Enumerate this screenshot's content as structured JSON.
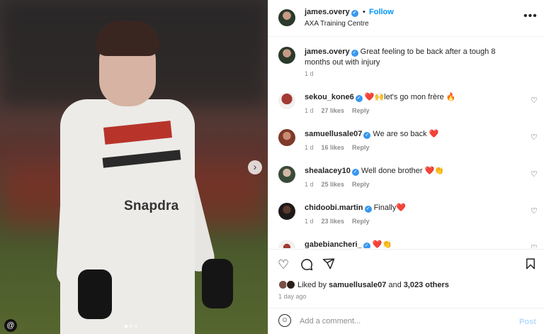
{
  "post": {
    "author": "james.overy",
    "follow_label": "Follow",
    "separator": "•",
    "location": "AXA Training Centre",
    "more_icon": "more-icon",
    "caption": {
      "author": "james.overy",
      "text": "Great feeling to be back after a tough 8 months out with injury",
      "time": "1 d"
    },
    "image_sponsor_text": "Snapdra",
    "carousel": {
      "slide": 1,
      "total": 3
    }
  },
  "comments": [
    {
      "user": "sekou_kone6",
      "text": "❤️🙌let's go mon frère 🔥",
      "time": "1 d",
      "likes": "27 likes",
      "reply": "Reply",
      "avatar_color": "#a33a33"
    },
    {
      "user": "samuellusale07",
      "text": "We are so back ❤️",
      "time": "1 d",
      "likes": "16 likes",
      "reply": "Reply",
      "avatar_color": "#7e3a2a"
    },
    {
      "user": "shealacey10",
      "text": "Well done brother ❤️👏",
      "time": "1 d",
      "likes": "25 likes",
      "reply": "Reply",
      "avatar_color": "#3a4a3a"
    },
    {
      "user": "chidoobi.martin",
      "text": "Finally❤️",
      "time": "1 d",
      "likes": "23 likes",
      "reply": "Reply",
      "avatar_color": "#1d1a19"
    },
    {
      "user": "gabebiancheri_",
      "text": "❤️👏",
      "time": "",
      "likes": "",
      "reply": "",
      "avatar_color": "#f3f0ee"
    }
  ],
  "actions": {
    "like_icon": "heart-icon",
    "comment_icon": "comment-icon",
    "share_icon": "share-icon",
    "save_icon": "bookmark-icon"
  },
  "likes": {
    "prefix": "Liked by",
    "user": "samuellusale07",
    "middle": "and",
    "others": "3,023 others"
  },
  "time_ago": "1 day ago",
  "add_comment": {
    "placeholder": "Add a comment...",
    "post_label": "Post"
  },
  "colors": {
    "accent": "#0095f6",
    "verified": "#3897f0",
    "muted": "#8e8e8e"
  }
}
